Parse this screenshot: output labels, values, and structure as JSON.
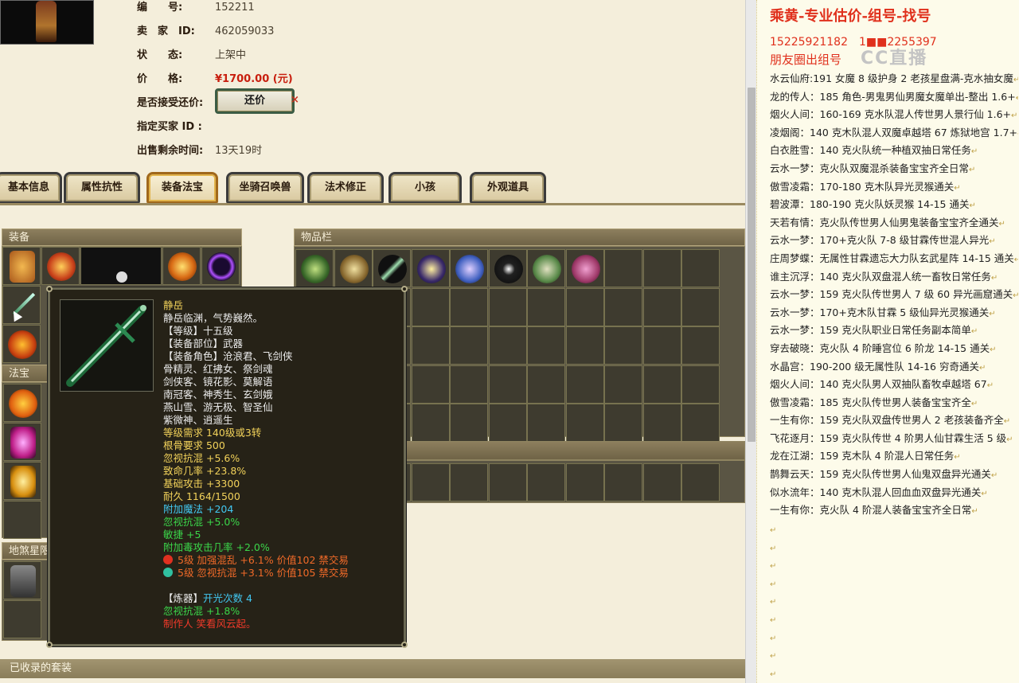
{
  "listing": {
    "fields": [
      {
        "label": "编　　号:",
        "value": "152211"
      },
      {
        "label": "卖　家　ID:",
        "value": "462059033"
      },
      {
        "label": "状　　态:",
        "value": "上架中"
      },
      {
        "label": "价　　格:",
        "value": "¥1700.00 (元)"
      },
      {
        "label": "是否接受还价:",
        "value": ""
      },
      {
        "label": "指定买家 ID :",
        "value": ""
      },
      {
        "label": "出售剩余时间:",
        "value": "13天19时"
      }
    ],
    "bargain_button": "还价",
    "close_mark": "×"
  },
  "tabs": [
    "基本信息",
    "属性抗性",
    "装备法宝",
    "坐骑召唤兽",
    "法术修正",
    "小孩",
    "外观道具"
  ],
  "active_tab": "装备法宝",
  "panels": {
    "equip": "装备",
    "inventory": "物品栏",
    "fabao": "法宝",
    "disha": "地煞星限",
    "suits": "已收录的套装"
  },
  "tooltip": {
    "name": "静岳",
    "lines": [
      {
        "t": "静岳临渊，气势巍然。",
        "c": "w"
      },
      {
        "t": "【等级】十五级",
        "c": "w"
      },
      {
        "t": "【装备部位】武器",
        "c": "w"
      },
      {
        "t": "【装备角色】沧浪君、飞剑侠",
        "c": "w"
      },
      {
        "t": "骨精灵、红拂女、祭剑魂",
        "c": "w"
      },
      {
        "t": "剑侠客、镜花影、莫解语",
        "c": "w"
      },
      {
        "t": "南冠客、神秀生、玄剑娥",
        "c": "w"
      },
      {
        "t": "燕山雪、游无极、智圣仙",
        "c": "w"
      },
      {
        "t": "紫微神、逍遥生",
        "c": "w"
      },
      {
        "t": "等级需求 140级或3转",
        "c": "y"
      },
      {
        "t": "根骨要求 500",
        "c": "y"
      },
      {
        "t": "忽视抗混 +5.6%",
        "c": "y"
      },
      {
        "t": "致命几率 +23.8%",
        "c": "y"
      },
      {
        "t": "基础攻击 +3300",
        "c": "y"
      },
      {
        "t": "耐久 1164/1500",
        "c": "y"
      },
      {
        "t": "附加魔法 +204",
        "c": "c"
      },
      {
        "t": "忽视抗混 +5.0%",
        "c": "g"
      },
      {
        "t": "敏捷 +5",
        "c": "g"
      },
      {
        "t": "附加毒攻击几率 +2.0%",
        "c": "g"
      }
    ],
    "gems": [
      {
        "t": "5级 加强混乱 +6.1% 价值102 禁交易",
        "color": "#e03020"
      },
      {
        "t": "5级 忽视抗混 +3.1% 价值105 禁交易",
        "color": "#30c0a0"
      }
    ],
    "refine_label": "【炼器】",
    "refine_value": "开光次数 4",
    "refine_stat": "忽视抗混 +1.8%",
    "maker": "制作人 笑看风云起。"
  },
  "doc": {
    "title": "乘黄-专业估价-组号-找号",
    "phone": "15225921182　1■■2255397",
    "circle": "朋友圈出组号",
    "watermark": "CC直播",
    "lines": [
      "水云仙府:191 女魔 8 级护身 2 老孩星盘满-克水抽女魔",
      "龙的传人：185 角色-男鬼男仙男魔女魔单出-整出 1.6+",
      "烟火人间：160-169 克水队混人传世男人景行仙 1.6+",
      "凌烟阁：140 克木队混人双魔卓越塔 67 炼狱地宫 1.7+",
      "白衣胜雪：140 克火队统一种植双抽日常任务",
      "云水一梦：克火队双魔混杀装备宝宝齐全日常",
      "傲雪凌霜：170-180 克木队异光灵猴通关",
      "碧波潭：180-190 克火队妖灵猴 14-15 通关",
      "天若有情：克火队传世男人仙男鬼装备宝宝齐全通关",
      "云水一梦：170+克火队 7-8 级甘霖传世混人异光",
      "庄周梦蝶：无属性甘霖遗忘大力队玄武星阵 14-15 通关",
      "谁主沉浮：140 克火队双盘混人统一畜牧日常任务",
      "云水一梦：159 克火队传世男人 7 级 60 异光画窟通关",
      "云水一梦：170+克木队甘霖 5 级仙异光灵猴通关",
      "云水一梦：159 克火队职业日常任务副本简单",
      "穿去破晓：克火队 4 阶睡宫位 6 阶龙 14-15 通关",
      "水晶宫：190-200 级无属性队 14-16 穷奇通关",
      "烟火人间：140 克火队男人双抽队畜牧卓越塔 67",
      "傲雪凌霜：185 克火队传世男人装备宝宝齐全",
      "一生有你：159 克火队双盘传世男人 2 老孩装备齐全",
      "飞花逐月：159 克火队传世 4 阶男人仙甘霖生活 5 级",
      "龙在江湖：159 克木队 4 阶混人日常任务",
      "鹊舞云天：159 克火队传世男人仙鬼双盘异光通关",
      "似水流年：140 克木队混人回血血双盘异光通关",
      "一生有你：克火队 4 阶混人装备宝宝齐全日常"
    ],
    "para_mark": "↵"
  },
  "colors": {
    "accent_red": "#e0301c",
    "panel_bg": "#5a5544",
    "tooltip_bg": "#262217"
  }
}
